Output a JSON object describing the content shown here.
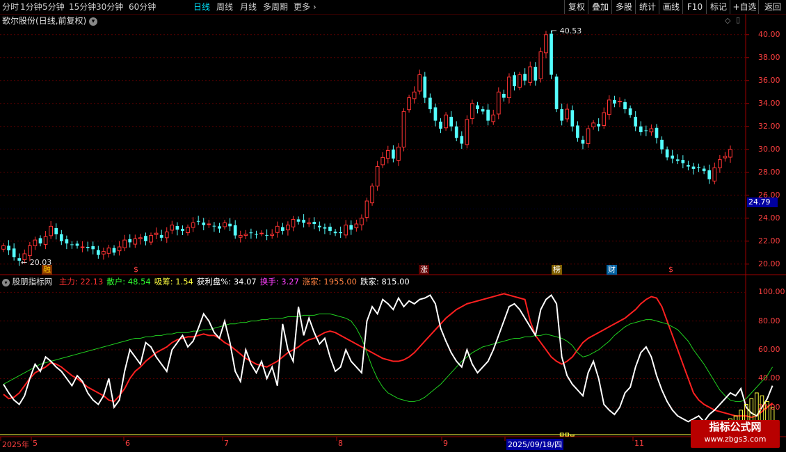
{
  "toolbar": {
    "periods": [
      "分时",
      "1分钟",
      "5分钟",
      "15分钟",
      "30分钟",
      "60分钟",
      "日线",
      "周线",
      "月线",
      "多周期"
    ],
    "active_period": "日线",
    "more_label": "更多",
    "right_buttons": [
      "复权",
      "叠加",
      "多股",
      "统计",
      "画线",
      "F10",
      "标记",
      "+自选",
      "返回"
    ]
  },
  "stock": {
    "name": "歌尔股份",
    "mode": "(日线,前复权)"
  },
  "price_axis": {
    "ticks": [
      "40.00",
      "38.00",
      "36.00",
      "34.00",
      "32.00",
      "30.00",
      "28.00",
      "26.00",
      "24.00",
      "22.00",
      "20.00"
    ],
    "current": "24.79"
  },
  "annotations": {
    "high": "40.53",
    "low": "20.03"
  },
  "events": [
    {
      "label": "融",
      "color": "#ffcc00",
      "bg": "#803000"
    },
    {
      "label": "$",
      "color": "#ff4040",
      "bg": ""
    },
    {
      "label": "涨",
      "color": "#ffffff",
      "bg": "#600000"
    },
    {
      "label": "榜",
      "color": "#ffffff",
      "bg": "#806000"
    },
    {
      "label": "财",
      "color": "#ffffff",
      "bg": "#0060a0"
    },
    {
      "label": "$",
      "color": "#ff4040",
      "bg": ""
    }
  ],
  "indicator": {
    "name": "股朋指标网",
    "fields": [
      {
        "label": "主力:",
        "value": "22.13",
        "color": "#ff3030"
      },
      {
        "label": "散户:",
        "value": "48.54",
        "color": "#30ff30"
      },
      {
        "label": "吸筹:",
        "value": "1.54",
        "color": "#ffff40"
      },
      {
        "label": "获利盘%:",
        "value": "34.07",
        "color": "#ffffff"
      },
      {
        "label": "换手:",
        "value": "3.27",
        "color": "#ff40ff"
      },
      {
        "label": "涨家:",
        "value": "1955.00",
        "color": "#ff8040"
      },
      {
        "label": "跌家:",
        "value": "815.00",
        "color": "#ffffff"
      }
    ],
    "axis_ticks": [
      "100.00",
      "80.00",
      "60.00",
      "40.00",
      "20.00"
    ]
  },
  "date_axis": {
    "labels": [
      "2025年",
      "5",
      "6",
      "7",
      "8",
      "9",
      "2025/09/18/四",
      "11"
    ]
  },
  "watermark": {
    "title": "指标公式网",
    "url": "www.zbgs3.com"
  },
  "colors": {
    "up": "#ff3333",
    "down": "#54ffff",
    "grid": "#5a0000",
    "bg": "#000000"
  },
  "chart_data": {
    "type": "candlestick",
    "price_high": 40.53,
    "price_low": 20.03,
    "ylim": [
      19.2,
      41.2
    ],
    "closes": [
      21.6,
      21.2,
      20.6,
      20.3,
      20.9,
      21.6,
      22.1,
      21.8,
      22.4,
      23.3,
      22.6,
      22.0,
      21.8,
      21.7,
      21.6,
      21.5,
      21.4,
      21.3,
      20.8,
      21.1,
      21.4,
      21.0,
      21.5,
      22.1,
      21.9,
      22.2,
      22.3,
      22.0,
      22.5,
      22.7,
      22.3,
      22.8,
      23.4,
      23.0,
      22.9,
      23.2,
      23.6,
      23.7,
      23.4,
      23.5,
      23.3,
      23.1,
      23.6,
      23.3,
      22.5,
      22.5,
      22.6,
      22.7,
      22.6,
      22.7,
      22.5,
      22.6,
      23.3,
      22.9,
      23.4,
      23.9,
      23.7,
      23.6,
      23.6,
      23.5,
      23.2,
      23.1,
      22.9,
      22.7,
      22.7,
      23.4,
      23.0,
      23.5,
      24.0,
      25.5,
      26.8,
      28.5,
      29.3,
      29.9,
      29.2,
      30.2,
      33.3,
      34.5,
      35.0,
      36.5,
      34.5,
      33.5,
      32.5,
      31.8,
      33.0,
      32.0,
      31.0,
      30.5,
      32.6,
      34.0,
      33.5,
      33.3,
      32.5,
      33.0,
      35.0,
      34.5,
      36.3,
      35.5,
      36.5,
      36.0,
      37.2,
      36.0,
      38.5,
      40.0,
      36.5,
      33.5,
      32.5,
      33.5,
      32.0,
      31.0,
      30.5,
      31.8,
      32.3,
      32.0,
      33.2,
      34.3,
      34.0,
      34.2,
      33.5,
      33.0,
      32.0,
      31.5,
      31.6,
      31.8,
      31.0,
      30.0,
      29.3,
      29.2,
      29.0,
      28.8,
      28.5,
      28.3,
      28.4,
      28.1,
      27.4,
      28.4,
      29.1,
      29.4,
      30.0
    ],
    "indicator_series": [
      {
        "name": "主力",
        "color": "#ff2020",
        "values": [
          29,
          26,
          27,
          30,
          35,
          40,
          44,
          46,
          48,
          51,
          50,
          48,
          45,
          42,
          40,
          37,
          34,
          32,
          30,
          28,
          25,
          24,
          28,
          33,
          40,
          45,
          48,
          52,
          55,
          58,
          60,
          62,
          65,
          67,
          68,
          69,
          69,
          70,
          71,
          70,
          70,
          68,
          65,
          63,
          60,
          57,
          54,
          52,
          50,
          49,
          48,
          50,
          52,
          55,
          58,
          60,
          62,
          65,
          67,
          68,
          70,
          72,
          73,
          72,
          70,
          68,
          66,
          64,
          62,
          60,
          58,
          56,
          54,
          53,
          52,
          52,
          53,
          55,
          58,
          62,
          66,
          70,
          74,
          78,
          82,
          85,
          88,
          90,
          92,
          93,
          94,
          95,
          96,
          97,
          98,
          99,
          98,
          97,
          96,
          95,
          80,
          70,
          65,
          60,
          55,
          52,
          50,
          52,
          55,
          60,
          65,
          68,
          70,
          72,
          74,
          76,
          78,
          80,
          82,
          85,
          88,
          92,
          95,
          97,
          96,
          90,
          80,
          70,
          60,
          50,
          40,
          30,
          25,
          22,
          20,
          18,
          17,
          16,
          15,
          14,
          14,
          14,
          13,
          14,
          17,
          20,
          23
        ]
      },
      {
        "name": "散户",
        "color": "#20d020",
        "values": [
          36,
          38,
          40,
          42,
          44,
          46,
          48,
          50,
          51,
          52,
          53,
          54,
          55,
          56,
          57,
          58,
          59,
          60,
          61,
          62,
          63,
          64,
          65,
          66,
          67,
          68,
          68,
          69,
          69,
          70,
          70,
          71,
          71,
          72,
          72,
          72,
          73,
          73,
          74,
          74,
          75,
          76,
          77,
          78,
          78,
          79,
          79,
          80,
          80,
          81,
          81,
          82,
          82,
          82,
          83,
          83,
          83,
          84,
          84,
          84,
          85,
          85,
          85,
          84,
          83,
          82,
          80,
          75,
          68,
          58,
          48,
          40,
          34,
          30,
          28,
          26,
          25,
          24,
          24,
          25,
          27,
          30,
          33,
          36,
          40,
          44,
          48,
          52,
          55,
          58,
          60,
          62,
          63,
          64,
          65,
          66,
          67,
          68,
          68,
          69,
          69,
          70,
          70,
          71,
          70,
          69,
          68,
          66,
          63,
          58,
          55,
          56,
          58,
          60,
          63,
          66,
          70,
          73,
          76,
          78,
          79,
          80,
          81,
          81,
          80,
          79,
          78,
          76,
          74,
          70,
          66,
          60,
          55,
          50,
          44,
          38,
          32,
          28,
          25,
          24,
          24,
          26,
          30,
          34,
          38,
          42,
          48
        ]
      },
      {
        "name": "获利盘",
        "color": "#ffffff",
        "values": [
          36,
          30,
          25,
          22,
          28,
          40,
          50,
          45,
          55,
          52,
          48,
          45,
          40,
          35,
          42,
          38,
          30,
          25,
          22,
          28,
          40,
          20,
          25,
          45,
          60,
          55,
          50,
          65,
          62,
          55,
          50,
          45,
          60,
          65,
          70,
          62,
          66,
          75,
          85,
          80,
          72,
          68,
          80,
          65,
          45,
          38,
          60,
          50,
          44,
          52,
          40,
          48,
          35,
          78,
          60,
          52,
          90,
          70,
          82,
          72,
          64,
          68,
          55,
          45,
          48,
          60,
          52,
          48,
          44,
          80,
          90,
          85,
          95,
          92,
          88,
          96,
          90,
          94,
          92,
          95,
          96,
          98,
          92,
          75,
          66,
          58,
          52,
          48,
          60,
          50,
          44,
          48,
          52,
          60,
          70,
          80,
          90,
          92,
          88,
          82,
          76,
          70,
          88,
          95,
          98,
          92,
          55,
          42,
          36,
          32,
          28,
          44,
          52,
          40,
          22,
          18,
          15,
          20,
          30,
          34,
          48,
          58,
          62,
          55,
          42,
          32,
          24,
          18,
          14,
          12,
          10,
          12,
          14,
          10,
          15,
          18,
          22,
          26,
          30,
          28,
          33,
          20,
          16,
          14,
          20,
          26,
          35
        ]
      },
      {
        "name": "吸筹",
        "color": "#ffff40",
        "values": [
          0,
          0,
          0,
          0,
          0,
          0,
          0,
          0,
          0,
          0,
          0,
          0,
          0,
          0,
          0,
          0,
          0,
          0,
          0,
          0,
          0,
          0,
          0,
          0,
          0,
          0,
          0,
          0,
          0,
          0,
          0,
          0,
          0,
          0,
          0,
          0,
          0,
          0,
          0,
          0,
          0,
          0,
          0,
          0,
          0,
          0,
          0,
          0,
          0,
          0,
          0,
          0,
          0,
          0,
          0,
          0,
          0,
          0,
          0,
          0,
          0,
          0,
          0,
          0,
          0,
          0,
          0,
          0,
          0,
          0,
          0,
          0,
          0,
          0,
          0,
          0,
          0,
          0,
          0,
          0,
          0,
          0,
          0,
          0,
          0,
          0,
          0,
          0,
          0,
          0,
          0,
          0,
          0,
          0,
          0,
          0,
          0,
          0,
          0,
          0,
          0,
          0,
          0,
          0,
          0,
          0,
          2,
          2,
          1,
          0,
          0,
          0,
          0,
          0,
          0,
          0,
          0,
          0,
          0,
          0,
          0,
          0,
          0,
          0,
          0,
          0,
          0,
          0,
          0,
          0,
          0,
          0,
          0,
          2,
          4,
          6,
          8,
          10,
          12,
          14,
          18,
          22,
          26,
          30,
          28,
          24,
          20
        ]
      }
    ],
    "indicator_ylim": [
      0,
      105
    ]
  }
}
